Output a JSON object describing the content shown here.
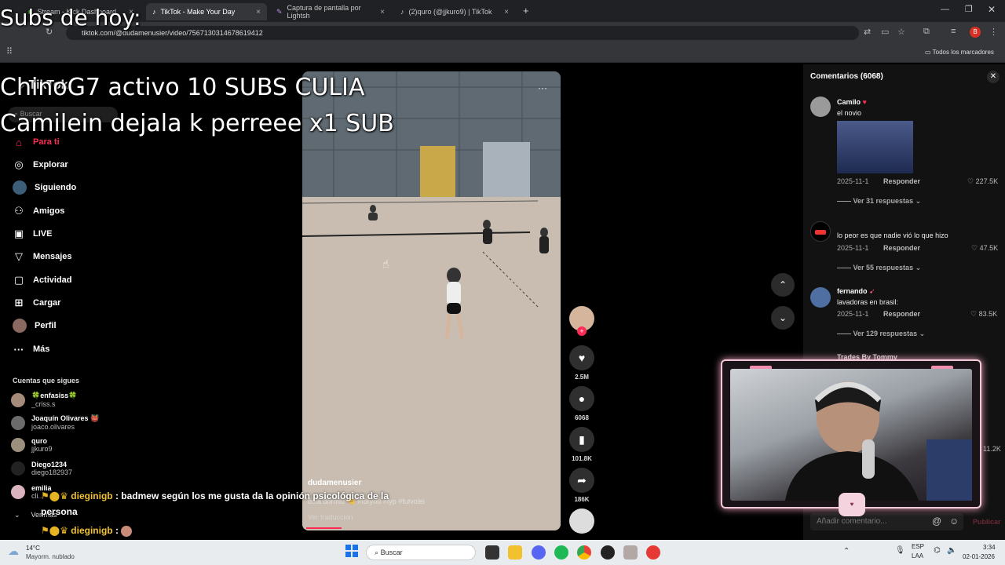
{
  "browser": {
    "tabs": [
      {
        "label": "Stream - Kick Dashboard"
      },
      {
        "label": "TikTok - Make Your Day"
      },
      {
        "label": "Captura de pantalla por Lightsh"
      },
      {
        "label": "(2)quro (@jjkuro9) | TikTok"
      }
    ],
    "url": "tiktok.com/@dudamenusier/video/7567130314678619412",
    "bookmarks_label": "Todos los marcadores",
    "profile_initial": "B"
  },
  "overlay": {
    "subs_title": "Subs de hoy:",
    "line1": "ChinoG7 activo 10 SUBS CULIA",
    "line2": "Camilein dejala k perreee x1 SUB"
  },
  "tiktok": {
    "logo": "TikTok",
    "search_placeholder": "Buscar",
    "nav": [
      {
        "label": "Para ti",
        "icon": "home-icon"
      },
      {
        "label": "Explorar",
        "icon": "compass-icon"
      },
      {
        "label": "Siguiendo",
        "icon": "following-icon"
      },
      {
        "label": "Amigos",
        "icon": "friends-icon"
      },
      {
        "label": "LIVE",
        "icon": "live-icon"
      },
      {
        "label": "Mensajes",
        "icon": "messages-icon"
      },
      {
        "label": "Actividad",
        "icon": "activity-icon"
      },
      {
        "label": "Cargar",
        "icon": "upload-icon"
      },
      {
        "label": "Perfil",
        "icon": "profile-icon"
      },
      {
        "label": "Más",
        "icon": "more-icon"
      }
    ],
    "following_title": "Cuentas que sigues",
    "following": [
      {
        "name": "🍀enfasiss🍀",
        "handle": "_criss.s"
      },
      {
        "name": "Joaquín Olivares 👹",
        "handle": "joaco.olivares"
      },
      {
        "name": "quro",
        "handle": "jjkuro9"
      },
      {
        "name": "Diego1234",
        "handle": "diego182937"
      },
      {
        "name": "emilia",
        "handle": "cli..."
      }
    ],
    "see_more": "Ver más",
    "video": {
      "author": "dudamenusier",
      "caption": "bola dormiu 🤏 #foryou #fyp #futvolei",
      "translate": "Ver traducción"
    },
    "actions": {
      "likes": "2.5M",
      "comments": "6068",
      "saves": "101.8K",
      "shares": "186K"
    }
  },
  "chat": {
    "msg1_user": "dieginigb",
    "msg1_text": ": badmew según los me gusta da la opinión psicológica de la",
    "msg1_text2": "persona",
    "msg2_user": "dieginigb",
    "msg2_text": ":"
  },
  "comments_panel": {
    "title": "Comentarios (6068)",
    "items": [
      {
        "name": "Camilo",
        "text": "el novio",
        "date": "2025-11-1",
        "reply": "Responder",
        "likes": "227.5K",
        "more": "Ver 31 respuestas"
      },
      {
        "name": "",
        "text": "lo peor es que nadie vió lo que hizo",
        "date": "2025-11-1",
        "reply": "Responder",
        "likes": "47.5K",
        "more": "Ver 55 respuestas"
      },
      {
        "name": "fernando",
        "text": "lavadoras en brasil:",
        "date": "2025-11-1",
        "reply": "Responder",
        "likes": "83.5K",
        "more": "Ver 129 respuestas"
      },
      {
        "name": "Trades By Tommy",
        "likes": "11.2K"
      }
    ],
    "add_placeholder": "Añadir comentario...",
    "publish": "Publicar"
  },
  "taskbar": {
    "temp": "14°C",
    "weather": "Mayorm. nublado",
    "search": "Buscar",
    "lang1": "ESP",
    "lang2": "LAA",
    "time": "3:34",
    "date": "02-01-2026"
  },
  "colors": {
    "accent": "#fe2c55",
    "webcam_border": "#f3c8d6"
  }
}
